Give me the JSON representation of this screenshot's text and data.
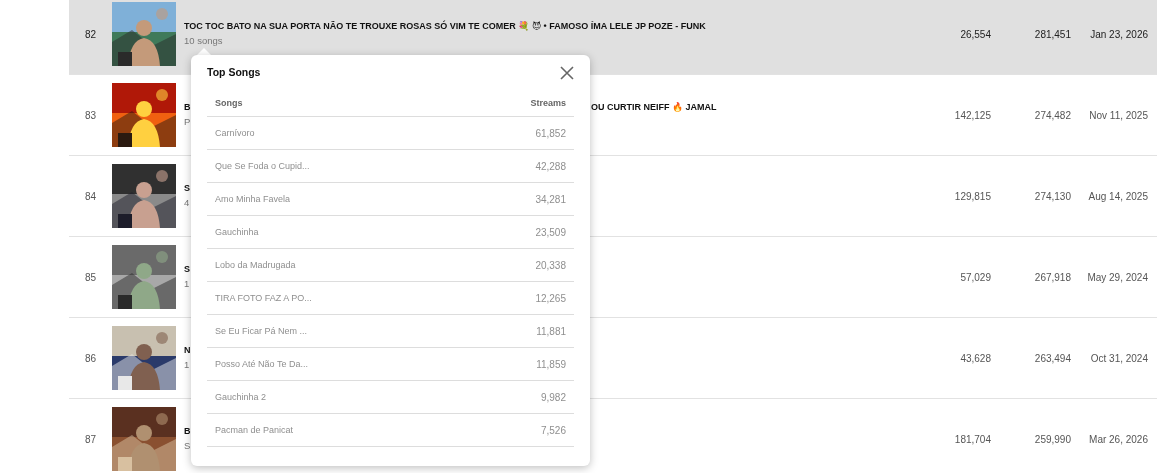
{
  "rows": [
    {
      "rank": "82",
      "title": [
        "TOC TOC BATO NA SUA PORTA NÃO TE TROUXE ROSAS SÓ VIM TE COMER 💐 😈 • FAMOSO ÍMA LELE JP POZE - FUNK"
      ],
      "subtitle": "10 songs",
      "column_1": "26,554",
      "column_2": "281,451",
      "column_3": "Jan 23, 2026",
      "selected": true
    },
    {
      "rank": "83",
      "title": [
        "B",
        "OU CURTIR NEIFF 🔥 JAMAL"
      ],
      "subtitle": "P",
      "column_1": "142,125",
      "column_2": "274,482",
      "column_3": "Nov 11, 2025",
      "selected": false
    },
    {
      "rank": "84",
      "title": [
        "S"
      ],
      "subtitle": "4",
      "column_1": "129,815",
      "column_2": "274,130",
      "column_3": "Aug 14, 2025",
      "selected": false
    },
    {
      "rank": "85",
      "title": [
        "S"
      ],
      "subtitle": "1",
      "column_1": "57,029",
      "column_2": "267,918",
      "column_3": "May 29, 2024",
      "selected": false
    },
    {
      "rank": "86",
      "title": [
        "N"
      ],
      "subtitle": "1",
      "column_1": "43,628",
      "column_2": "263,494",
      "column_3": "Oct 31, 2024",
      "selected": false
    },
    {
      "rank": "87",
      "title": [
        "B"
      ],
      "subtitle": "S",
      "column_1": "181,704",
      "column_2": "259,990",
      "column_3": "Mar 26, 2026",
      "selected": false
    }
  ],
  "popup": {
    "title": "Top Songs",
    "columns": [
      "Songs",
      "Streams"
    ],
    "songs": [
      {
        "name": "Carnívoro",
        "streams": "61,852"
      },
      {
        "name": "Que Se Foda o Cupid...",
        "streams": "42,288"
      },
      {
        "name": "Amo Minha Favela",
        "streams": "34,281"
      },
      {
        "name": "Gauchinha",
        "streams": "23,509"
      },
      {
        "name": "Lobo da Madrugada",
        "streams": "20,338"
      },
      {
        "name": "TIRA FOTO FAZ A PO...",
        "streams": "12,265"
      },
      {
        "name": "Se Eu Ficar Pá Nem ...",
        "streams": "11,881"
      },
      {
        "name": "Posso Até Não Te Da...",
        "streams": "11,859"
      },
      {
        "name": "Gauchinha 2",
        "streams": "9,982"
      },
      {
        "name": "Pacman de Panicat",
        "streams": "7,526"
      }
    ]
  }
}
